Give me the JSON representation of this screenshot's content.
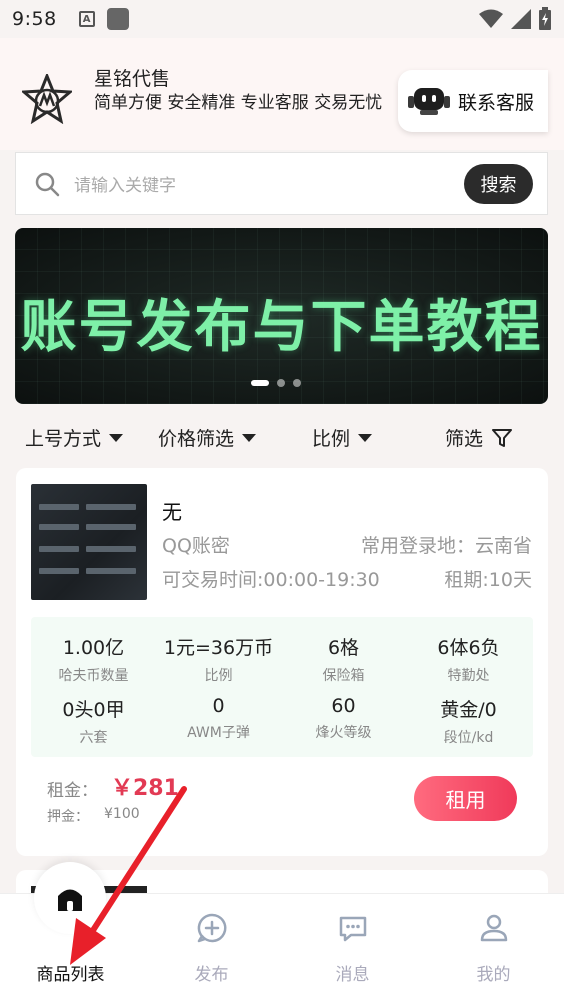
{
  "status_bar": {
    "time": "9:58",
    "notification_letter": "A"
  },
  "header": {
    "brand_name": "星铭代售",
    "brand_desc": "简单方便 安全精准 专业客服 交易无忧",
    "contact_label": "联系客服"
  },
  "search": {
    "placeholder": "请输入关键字",
    "button_label": "搜索"
  },
  "banner": {
    "text": "账号发布与下单教程",
    "slide_count": 3,
    "active_slide": 1
  },
  "filters": [
    {
      "label": "上号方式"
    },
    {
      "label": "价格筛选"
    },
    {
      "label": "比例"
    },
    {
      "label": "筛选"
    }
  ],
  "listing": {
    "title": "无",
    "account_type": "QQ账密",
    "login_location": "常用登录地：云南省",
    "trade_time": "可交易时间:00:00-19:30",
    "lease_term": "租期:10天",
    "stats": [
      {
        "value": "1.00亿",
        "label": "哈夫币数量"
      },
      {
        "value": "1元=36万币",
        "label": "比例"
      },
      {
        "value": "6格",
        "label": "保险箱"
      },
      {
        "value": "6体6负",
        "label": "特勤处"
      },
      {
        "value": "0头0甲",
        "label": "六套"
      },
      {
        "value": "0",
        "label": "AWM子弹"
      },
      {
        "value": "60",
        "label": "烽火等级"
      },
      {
        "value": "黄金/0",
        "label": "段位/kd"
      }
    ],
    "rent_label": "租金：",
    "rent_value": "￥281",
    "deposit_label": "押金：",
    "deposit_value": "¥100",
    "rent_button": "租用"
  },
  "tabbar": [
    {
      "label": "商品列表",
      "icon": "home-icon",
      "active": true
    },
    {
      "label": "发布",
      "icon": "publish-icon",
      "active": false
    },
    {
      "label": "消息",
      "icon": "message-icon",
      "active": false
    },
    {
      "label": "我的",
      "icon": "profile-icon",
      "active": false
    }
  ],
  "colors": {
    "accent": "#f03a5a",
    "banner_text": "#7ef0a8",
    "annotation_arrow": "#e8202a"
  }
}
